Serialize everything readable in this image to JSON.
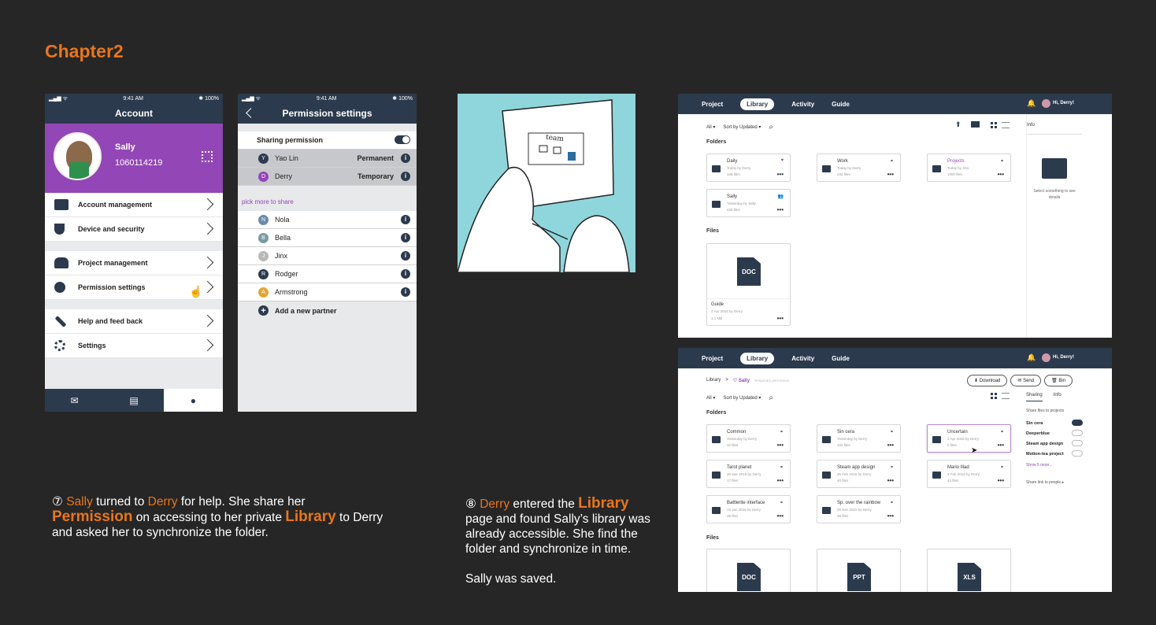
{
  "chapter_title": "Chapter2",
  "phone1": {
    "status": {
      "signal": "▂▄▆ ᯤ",
      "time": "9:41 AM",
      "battery": "✱ 100%"
    },
    "header_title": "Account",
    "user_name": "Sally",
    "user_id": "1060114219",
    "menu": [
      {
        "label": "Account management"
      },
      {
        "label": "Device and security"
      },
      {
        "label": "Project management"
      },
      {
        "label": "Permission settings"
      },
      {
        "label": "Help and feed back"
      },
      {
        "label": "Settings"
      }
    ],
    "tabs": [
      "✉",
      "▤",
      "●"
    ]
  },
  "phone2": {
    "status": {
      "signal": "▂▄▆ ᯤ",
      "time": "9:41 AM",
      "battery": "✱ 100%"
    },
    "header_title": "Permission settings",
    "sharing_label": "Sharing permission",
    "shared": [
      {
        "initial": "Y",
        "name": "Yao Lin",
        "perm": "Permanent"
      },
      {
        "initial": "D",
        "name": "Derry",
        "perm": "Temporary"
      }
    ],
    "pick_label": "pick more to share",
    "partners": [
      {
        "initial": "N",
        "name": "Nola"
      },
      {
        "initial": "B",
        "name": "Bella"
      },
      {
        "initial": "J",
        "name": "Jinx"
      },
      {
        "initial": "R",
        "name": "Rodger"
      },
      {
        "initial": "A",
        "name": "Armstrong"
      }
    ],
    "add_label": "Add a new partner"
  },
  "story7": {
    "num": "⑦",
    "p1": "Sally",
    "p2": " turned to ",
    "p3": "Derry",
    "p4": " for help. She share her",
    "p5": "Permission",
    "p6": " on accessing to her private ",
    "p7": "Library",
    "p8": " to Derry",
    "p9": "and asked her to synchronize the folder."
  },
  "story8": {
    "num": "⑧",
    "p1": "Derry",
    "p2": " entered the ",
    "p3": "Library",
    "p4": "page and found Sally’s library was",
    "p5": "already accessible. She find the",
    "p6": "folder and synchronize in time.",
    "p7": "Sally was saved."
  },
  "sketch_text": "team",
  "web1": {
    "nav": [
      "Project",
      "Library",
      "Activity",
      "Guide"
    ],
    "user": "Hi, Derry!",
    "filter_all": "All ▾",
    "sort": "Sort by Updated ▾",
    "folders_label": "Folders",
    "files_label": "Files",
    "info_label": "Info",
    "info_hint": "Select something to see details",
    "folders": [
      {
        "name": "Daily",
        "sub": "Today by Derry",
        "count": "108 files",
        "mark": "♥"
      },
      {
        "name": "Work",
        "sub": "Today by Derry",
        "count": "232 files",
        "mark": "⚭"
      },
      {
        "name": "Projects",
        "sub": "Today by Jinx",
        "count": "1000 files",
        "mark": "⚭"
      },
      {
        "name": "Sally",
        "sub": "Yesterday by Sally",
        "count": "420 files",
        "mark": "👥"
      }
    ],
    "file": {
      "type": "DOC",
      "name": "Guide",
      "sub": "2 Apr 2016 by Derry",
      "size": "1.1 MB"
    }
  },
  "web2": {
    "nav": [
      "Project",
      "Library",
      "Activity",
      "Guide"
    ],
    "user": "Hi, Derry!",
    "crumb_root": "Library",
    "crumb_sep": ">",
    "crumb_folder": "♡ Sally",
    "crumb_note": "Temporary permission",
    "btn_download": "⬇ Download",
    "btn_send": "✉ Send",
    "btn_bin": "🗑 Bin",
    "filter_all": "All ▾",
    "sort": "Sort by Updated ▾",
    "tab_sharing": "Sharing",
    "tab_info": "Info",
    "share_files": "Share files to projects",
    "projects": [
      {
        "name": "Sin cera",
        "on": true
      },
      {
        "name": "Deeperblue",
        "on": false
      },
      {
        "name": "Steam app design",
        "on": false
      },
      {
        "name": "Motion-tea project",
        "on": false
      }
    ],
    "show_more": "Show 5 more...",
    "share_link": "Share link to people ▸",
    "folders_label": "Folders",
    "files_label": "Files",
    "folders": [
      {
        "name": "Common",
        "sub": "Yesterday by Derry",
        "count": "40 files"
      },
      {
        "name": "Sin cera",
        "sub": "Yesterday by Derry",
        "count": "102 files"
      },
      {
        "name": "Uncertain",
        "sub": "2 Apr 2016 by Derry",
        "count": "6 files"
      },
      {
        "name": "Tarot planet",
        "sub": "30 Mar 2016 by Derry",
        "count": "17 files"
      },
      {
        "name": "Steam app design",
        "sub": "25 Feb 2016 by Derry",
        "count": "40 files"
      },
      {
        "name": "Mario Illad",
        "sub": "3 Feb 2016 by Derry",
        "count": "43 files"
      },
      {
        "name": "Battlerite interface",
        "sub": "15 Jan 2016 by Derry",
        "count": "38 files"
      },
      {
        "name": "Sp. over the rainbow",
        "sub": "25 Dec 2015 by Derry",
        "count": "38 files"
      }
    ],
    "files": [
      "DOC",
      "PPT",
      "XLS"
    ]
  }
}
